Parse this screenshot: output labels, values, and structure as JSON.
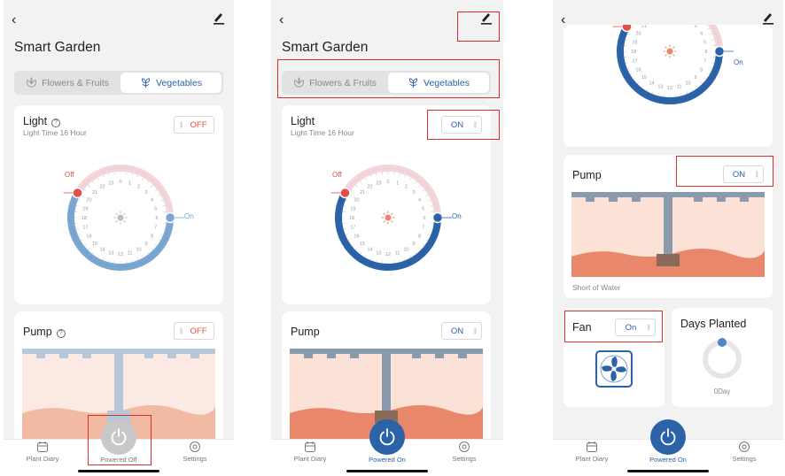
{
  "app": {
    "title": "Smart Garden",
    "tabs": [
      {
        "label": "Flowers & Fruits"
      },
      {
        "label": "Vegetables"
      }
    ]
  },
  "light": {
    "title": "Light",
    "subtitle": "Light Time 16 Hour",
    "off_toggle": "OFF",
    "on_toggle": "ON",
    "dial_off_label": "Off",
    "dial_on_label": "On",
    "hour_labels": [
      "1",
      "2",
      "3",
      "4",
      "5",
      "6",
      "7",
      "8",
      "9",
      "10",
      "11",
      "12",
      "13",
      "14",
      "15",
      "16",
      "17",
      "18",
      "19",
      "20",
      "21",
      "22",
      "23",
      "0"
    ],
    "timer_on_fraction": 0.6667
  },
  "pump": {
    "title": "Pump",
    "off_toggle": "OFF",
    "on_toggle": "ON",
    "status": "Short of Water"
  },
  "fan": {
    "title": "Fan",
    "toggle": "On"
  },
  "days": {
    "title": "Days Planted",
    "value": "0Day"
  },
  "nav": {
    "plant_diary": "Plant Diary",
    "powered_off": "Powered Off",
    "powered_on": "Powered On",
    "settings": "Settings"
  },
  "icons": {
    "back": "chevron-left-icon",
    "edit": "pencil-icon",
    "help": "question-icon",
    "sun": "sun-icon",
    "fan": "fan-icon",
    "power": "power-icon",
    "diary": "calendar-icon",
    "settings": "gear-icon",
    "flower": "flower-icon",
    "leaf": "leaf-icon"
  },
  "colors": {
    "accent_blue": "#2b62a8",
    "soft_blue": "#7aa6d2",
    "red_off": "#e0504a",
    "highlight": "#d9302b",
    "terracotta": "#e8876a",
    "power_gray": "#c8c8c8"
  }
}
